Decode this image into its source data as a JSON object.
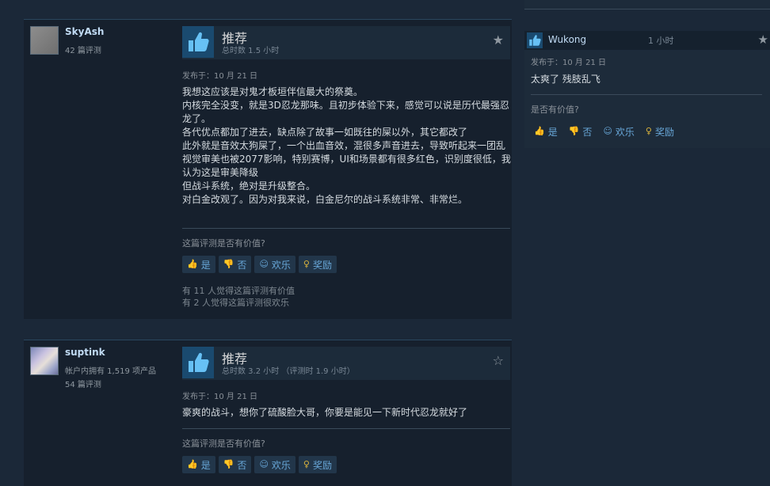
{
  "reviews": [
    {
      "author": {
        "name": "SkyAsh",
        "line1": "42 篇评测",
        "line2": ""
      },
      "vote": "推荐",
      "hours": "总时数 1.5 小时",
      "posted": "发布于：10 月 21 日",
      "content": [
        "我想这应该是对鬼才板垣伴信最大的祭奠。",
        "内核完全没变，就是3D忍龙那味。且初步体验下来，感觉可以说是历代最强忍龙了。",
        "各代优点都加了进去，缺点除了故事一如既往的屎以外，其它都改了",
        "此外就是音效太狗屎了，一个出血音效，混很多声音进去，导致听起来一团乱",
        "视觉审美也被2077影响，特别赛博，UI和场景都有很多红色，识别度很低，我认为这是审美降级",
        "但战斗系统，绝对是升级整合。",
        "对白金改观了。因为对我来说，白金尼尔的战斗系统非常、非常烂。"
      ],
      "helpful_question": "这篇评测是否有价值?",
      "buttons": {
        "yes": "是",
        "no": "否",
        "funny": "欢乐",
        "award": "奖励"
      },
      "counts": [
        "有 11 人觉得这篇评测有价值",
        "有 2 人觉得这篇评测很欢乐"
      ],
      "star_color": "#8f98a0"
    },
    {
      "author": {
        "name": "suptink",
        "line1": "帐户内拥有 1,519 项产品",
        "line2": "54 篇评测"
      },
      "vote": "推荐",
      "hours": "总时数 3.2 小时 （评测时 1.9 小时）",
      "posted": "发布于：10 月 21 日",
      "content": [
        "豪爽的战斗，想你了硫酸脸大哥，你要是能见一下新时代忍龙就好了"
      ],
      "helpful_question": "这篇评测是否有价值?",
      "buttons": {
        "yes": "是",
        "no": "否",
        "funny": "欢乐",
        "award": "奖励"
      },
      "counts": [],
      "star_color": "#8f98a0"
    }
  ],
  "side_review": {
    "name": "Wukong",
    "hours": "1 小时",
    "posted": "发布于：10 月 21 日",
    "text": "太爽了 残肢乱飞",
    "helpful_question": "是否有价值?",
    "buttons": {
      "yes": "是",
      "no": "否",
      "funny": "欢乐",
      "award": "奖励"
    }
  },
  "icons": {
    "thumbs_up": "thumbs-up-icon",
    "thumbs_down": "thumbs-down-icon",
    "smile": "smile-icon",
    "award": "award-icon",
    "star": "star-icon"
  },
  "colors": {
    "accent": "#68a7d8",
    "award": "#d7b13c",
    "thumb": "#67c1f5"
  }
}
